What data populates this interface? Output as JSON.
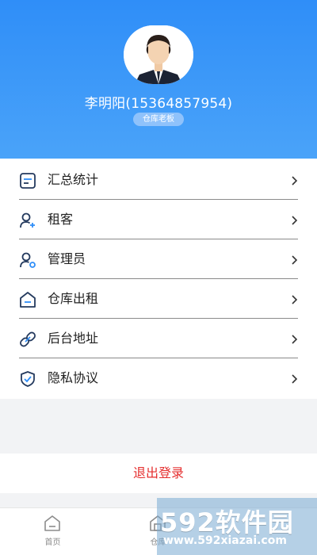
{
  "profile": {
    "name": "李明阳(15364857954)",
    "role": "仓库老板"
  },
  "menu": {
    "items": [
      {
        "label": "汇总统计",
        "icon": "summary-icon"
      },
      {
        "label": "租客",
        "icon": "tenant-icon"
      },
      {
        "label": "管理员",
        "icon": "admin-icon"
      },
      {
        "label": "仓库出租",
        "icon": "warehouse-icon"
      },
      {
        "label": "后台地址",
        "icon": "link-icon"
      },
      {
        "label": "隐私协议",
        "icon": "shield-icon"
      }
    ]
  },
  "logout": {
    "label": "退出登录"
  },
  "tabbar": {
    "tabs": [
      {
        "label": "首页",
        "icon": "home-icon"
      },
      {
        "label": "仓库",
        "icon": "warehouse-tab-icon"
      }
    ]
  },
  "watermark": {
    "brand": "592软件园",
    "url": "www.592xiazai.com"
  },
  "colors": {
    "header": "#2f8ef8",
    "logout": "#e52e2e",
    "badge": "#8fc2fb"
  }
}
